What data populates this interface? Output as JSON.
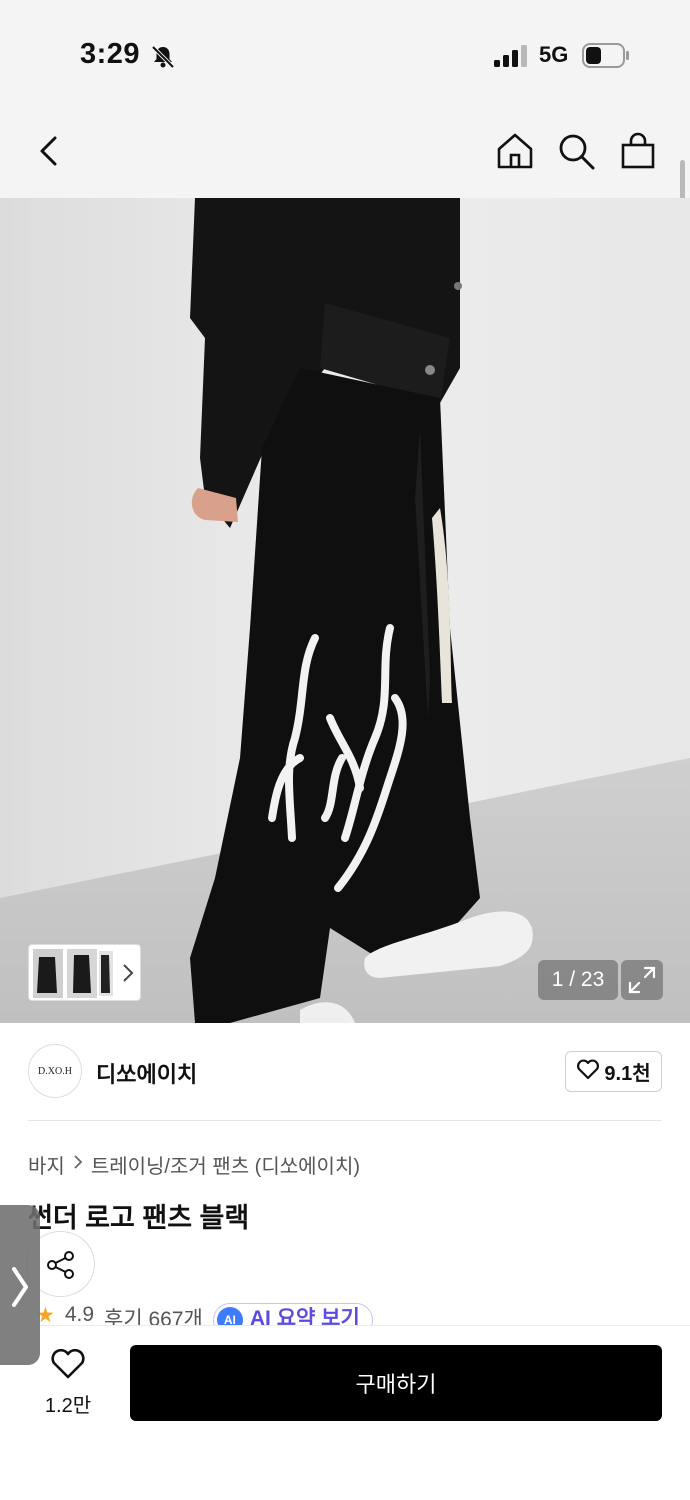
{
  "status_bar": {
    "time": "3:29",
    "network": "5G",
    "icons": [
      "bell-slash-icon",
      "signal-icon",
      "battery-icon"
    ]
  },
  "nav": {
    "icons": [
      "back-icon",
      "home-icon",
      "search-icon",
      "shopping-bag-icon"
    ]
  },
  "gallery": {
    "counter": "1 / 23",
    "current_index": 1,
    "total": 23
  },
  "brand": {
    "logo_text": "D.XO.H",
    "name": "디쏘에이치",
    "likes": "9.1천"
  },
  "breadcrumb": {
    "category": "바지",
    "subcategory": "트레이닝/조거 팬츠 (디쏘에이치)"
  },
  "product": {
    "title": "썬더 로고 팬츠 블랙",
    "rating": "4.9",
    "reviews": "후기 667개",
    "ai_badge": "AI",
    "ai_summary_label": "AI 요약 보기"
  },
  "bottom": {
    "wish_count": "1.2만",
    "buy_label": "구매하기"
  },
  "colors": {
    "buy_button": "#000000",
    "ai_accent": "#5a4ce0",
    "star": "#f5a623"
  }
}
